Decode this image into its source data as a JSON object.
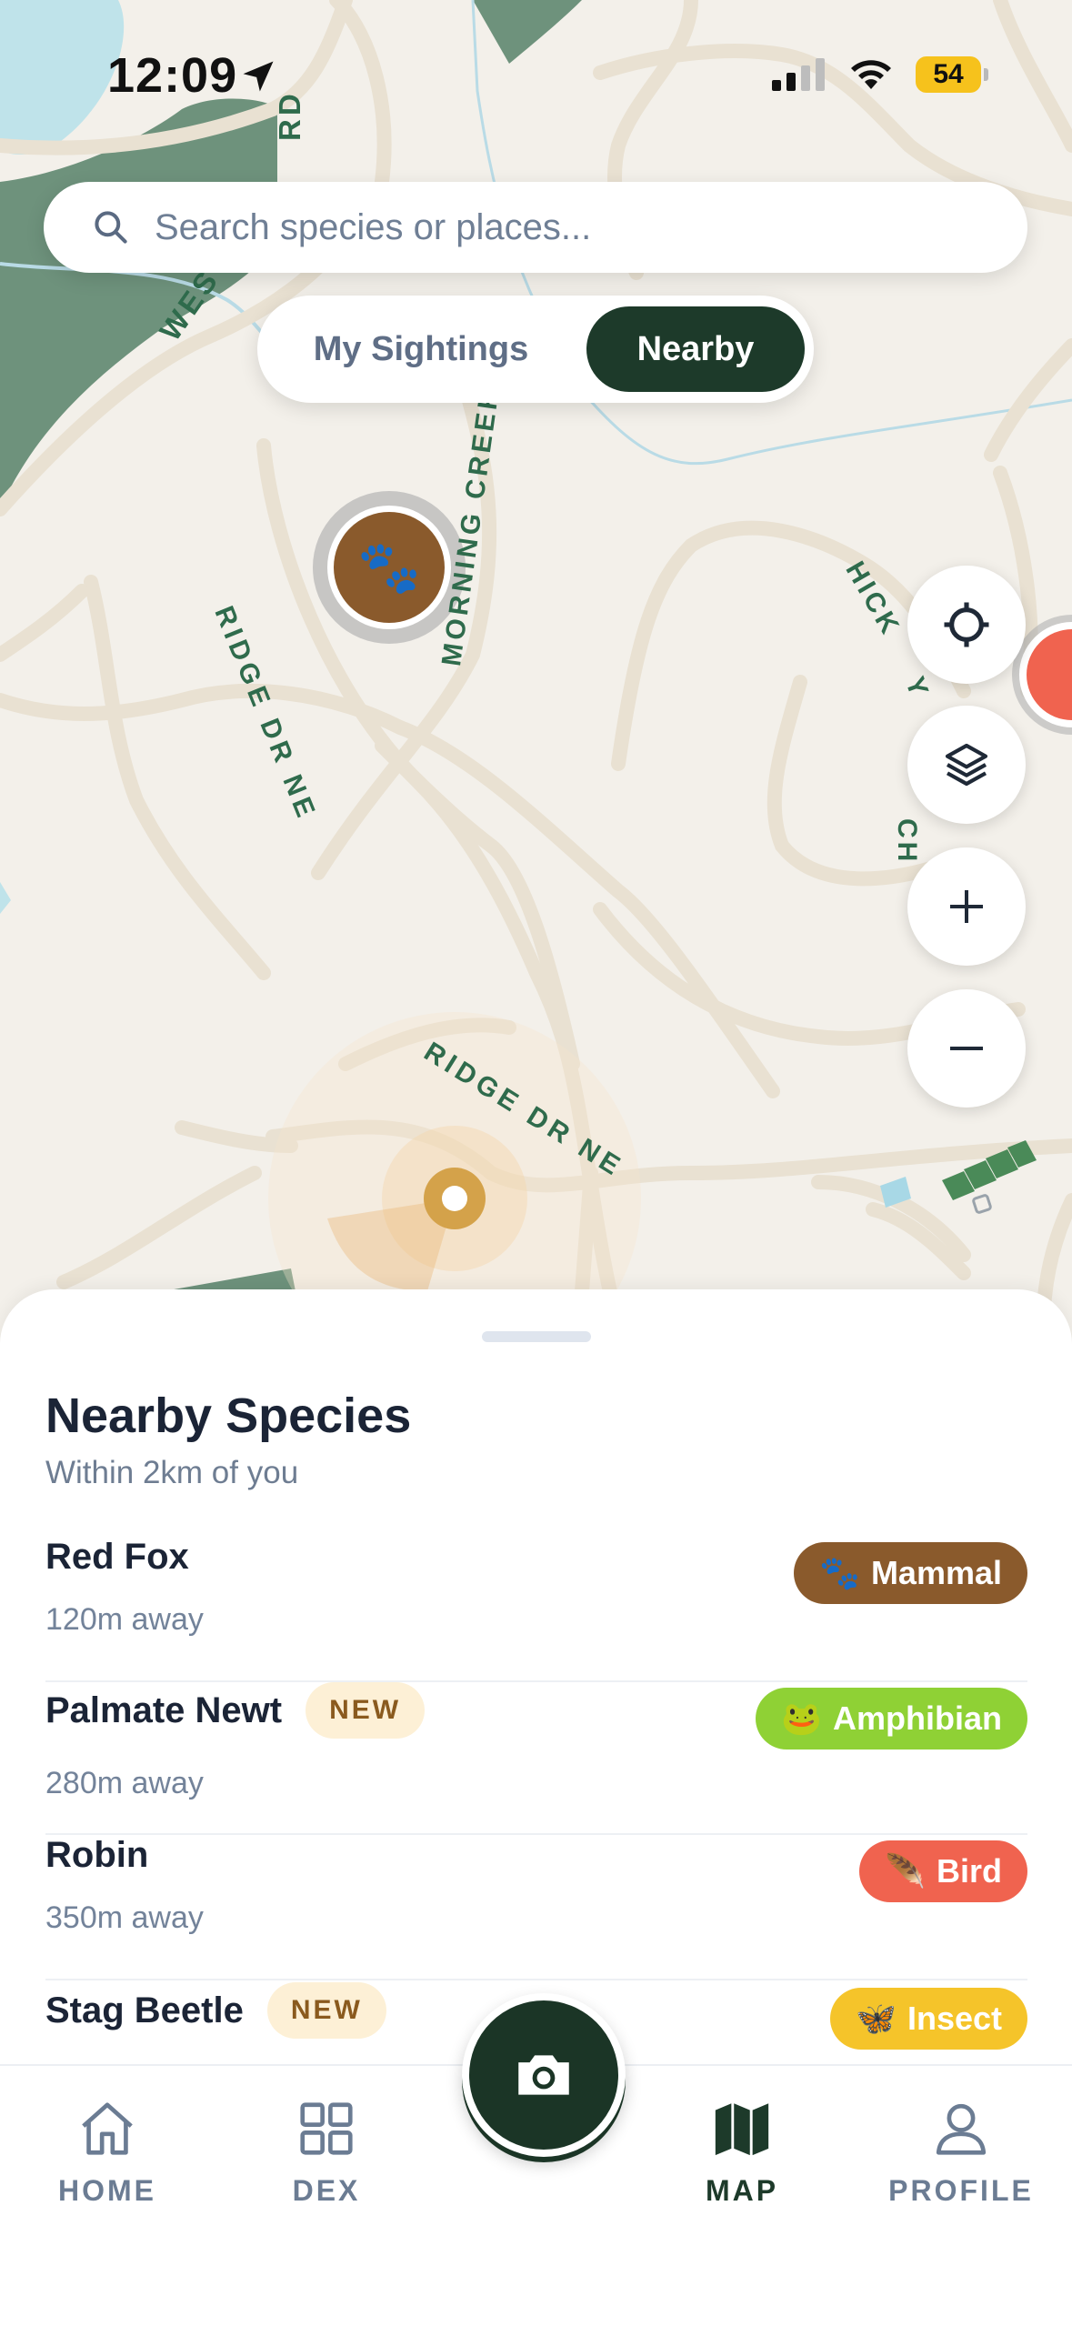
{
  "status_bar": {
    "time": "12:09",
    "battery": "54"
  },
  "search": {
    "placeholder": "Search species or places..."
  },
  "segmented": {
    "option1": "My Sightings",
    "option2": "Nearby",
    "active": "Nearby"
  },
  "map": {
    "street_labels": [
      "WESTRO",
      "RD",
      "MORNING CREEK",
      "RIDGE DR NE",
      "RIDGE DR NE",
      "HICK",
      "Y",
      "CH"
    ]
  },
  "map_controls": [
    "locate-button",
    "layers-button",
    "zoom-in-button",
    "zoom-out-button"
  ],
  "sheet": {
    "title": "Nearby Species",
    "subtitle": "Within 2km of you",
    "species": [
      {
        "name": "Red Fox",
        "distance": "120m away",
        "new": "",
        "category": "Mammal",
        "emoji": "🐾",
        "color": "#8a5a2c"
      },
      {
        "name": "Palmate Newt",
        "distance": "280m away",
        "new": "NEW",
        "category": "Amphibian",
        "emoji": "🐸",
        "color": "#8fd135"
      },
      {
        "name": "Robin",
        "distance": "350m away",
        "new": "",
        "category": "Bird",
        "emoji": "🪶",
        "color": "#f0634f"
      },
      {
        "name": "Stag Beetle",
        "distance": "",
        "new": "NEW",
        "category": "Insect",
        "emoji": "🦋",
        "color": "#f5c42a"
      }
    ]
  },
  "tabs": [
    {
      "label": "HOME"
    },
    {
      "label": "DEX"
    },
    {
      "label": "MAP"
    },
    {
      "label": "PROFILE"
    }
  ],
  "colors": {
    "accent": "#1d3a2a",
    "map_bg": "#f3f0ea",
    "road": "#e9e1d2",
    "park": "#6e927c",
    "water": "#bfe3ea"
  }
}
